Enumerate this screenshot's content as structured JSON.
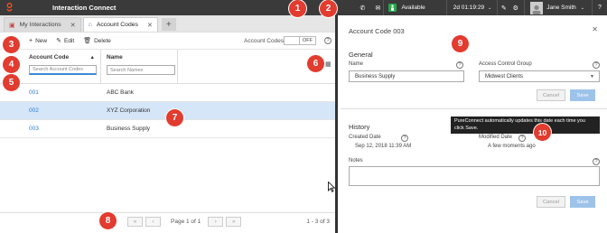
{
  "app": {
    "title": "Interaction Connect"
  },
  "topbar": {
    "status": "Available",
    "timer": "2d 01:19:29",
    "user": "Jane Smith",
    "help": "?"
  },
  "tabs": [
    {
      "label": "My Interactions",
      "icon": "inbox-icon"
    },
    {
      "label": "Account Codes",
      "icon": "home-icon"
    }
  ],
  "toolbar": {
    "new_label": "New",
    "edit_label": "Edit",
    "delete_label": "Delete",
    "account_codes_label": "Account Codes:",
    "toggle_value": "OFF"
  },
  "grid": {
    "columns": [
      {
        "label": "Account Code",
        "filter_placeholder": "Search Account Codes"
      },
      {
        "label": "Name",
        "filter_placeholder": "Search Names"
      }
    ],
    "rows": [
      {
        "code": "001",
        "name": "ABC Bank"
      },
      {
        "code": "002",
        "name": "XYZ Corporation"
      },
      {
        "code": "003",
        "name": "Business Supply"
      }
    ]
  },
  "pager": {
    "page_text": "Page 1 of 1",
    "count_text": "1 - 3 of 3"
  },
  "detail": {
    "title": "Account Code 003",
    "general_heading": "General",
    "name_label": "Name",
    "name_value": "Business Supply",
    "acg_label": "Access Control Group",
    "acg_value": "Midwest Clients",
    "cancel_label": "Cancel",
    "save_label": "Save",
    "history_heading": "History",
    "created_label": "Created Date",
    "created_value": "Sep 12, 2018 11:39 AM",
    "modified_label": "Modified Date",
    "modified_value": "A few moments ago",
    "notes_label": "Notes",
    "tooltip": "PureConnect automatically updates this date each time you click Save."
  },
  "badges": [
    "1",
    "2",
    "3",
    "4",
    "5",
    "6",
    "7",
    "8",
    "9",
    "10"
  ],
  "colors": {
    "badge": "#e23b2f",
    "accent": "#2a7ad2",
    "selected_row": "#d5e6f8",
    "topbar": "#3a3a3a"
  }
}
